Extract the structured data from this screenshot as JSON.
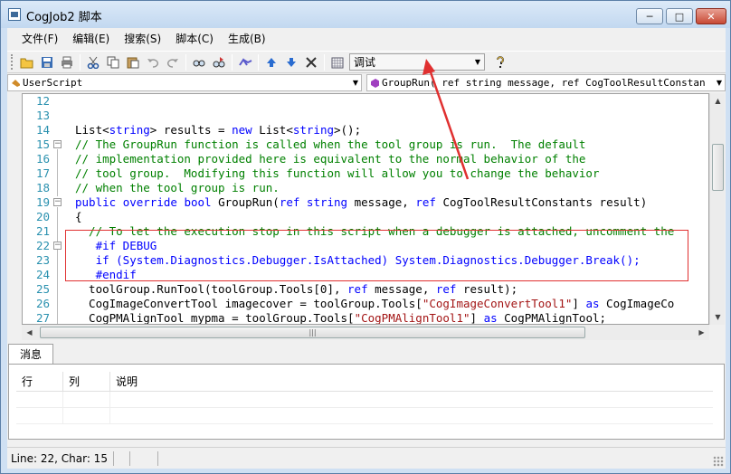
{
  "window": {
    "title": "CogJob2 脚本",
    "min_glyph": "─",
    "max_glyph": "□",
    "close_glyph": "✕"
  },
  "menu": [
    "文件(F)",
    "编辑(E)",
    "搜索(S)",
    "脚本(C)",
    "生成(B)"
  ],
  "toolbar": {
    "icons": [
      "open-folder",
      "save",
      "print",
      "cut",
      "copy",
      "paste",
      "undo",
      "redo",
      "find",
      "replace",
      "indent",
      "move-up",
      "move-down",
      "delete",
      "calendar",
      "help"
    ],
    "config_combo": "调试"
  },
  "nav": {
    "left": "UserScript",
    "right": "GroupRun( ref string message,  ref CogToolResultConstan"
  },
  "editor": {
    "line_numbers": [
      "12",
      "13",
      "14",
      "15",
      "16",
      "17",
      "18",
      "19",
      "20",
      "21",
      "22",
      "23",
      "24",
      "25",
      "26",
      "27"
    ],
    "lines": {
      "l14a": "List<",
      "l14b": "string",
      "l14c": "> results = ",
      "l14d": "new",
      "l14e": " List<",
      "l14f": "string",
      "l14g": ">();",
      "l15": "// The GroupRun function is called when the tool group is run.  The default",
      "l16": "// implementation provided here is equivalent to the normal behavior of the",
      "l17": "// tool group.  Modifying this function will allow you to change the behavior",
      "l18": "// when the tool group is run.",
      "l19a": "public",
      "l19b": " ",
      "l19c": "override",
      "l19d": " ",
      "l19e": "bool",
      "l19f": " GroupRun(",
      "l19g": "ref",
      "l19h": " ",
      "l19i": "string",
      "l19j": " message, ",
      "l19k": "ref",
      "l19l": " CogToolResultConstants result)",
      "l21": "{",
      "l22": "  // To let the execution stop in this script when a debugger is attached, uncomment the",
      "l23": "   #if DEBUG",
      "l24a": "   if (System.Diagnostics.Debugger.IsAttached) System.Diagnostics.Debugger.Break();",
      "l25": "   #endif",
      "l26a": "  toolGroup.RunTool(toolGroup.Tools[0], ",
      "l26b": "ref",
      "l26c": " message, ",
      "l26d": "ref",
      "l26e": " result);",
      "l27a": "  CogImageConvertTool imagecover = toolGroup.Tools[",
      "l27b": "\"CogImageConvertTool1\"",
      "l27c": "] ",
      "l27d": "as",
      "l27e": " CogImageCo",
      "l28a": "  CogPMAlignTool mypma = toolGroup.Tools[",
      "l28b": "\"CogPMAlignTool1\"",
      "l28c": "] ",
      "l28d": "as",
      "l28e": " CogPMAlignTool;"
    }
  },
  "messages": {
    "tab": "消息",
    "columns": [
      "行",
      "列",
      "说明"
    ]
  },
  "status": {
    "text": "Line: 22, Char: 15"
  },
  "colors": {
    "annotation": "#e03030"
  }
}
